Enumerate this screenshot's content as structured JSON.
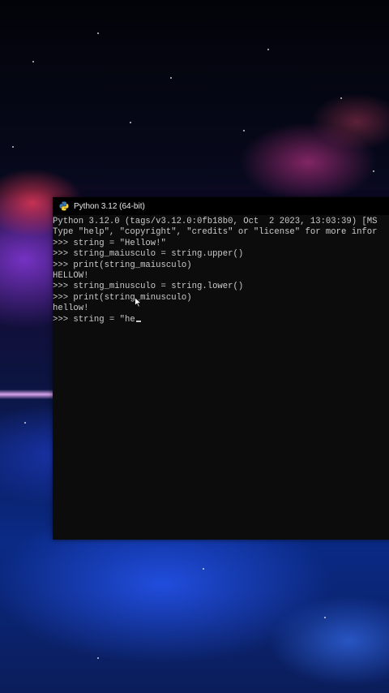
{
  "window": {
    "title": "Python 3.12 (64-bit)",
    "icon": "python-icon"
  },
  "console": {
    "lines": [
      "Python 3.12.0 (tags/v3.12.0:0fb18b0, Oct  2 2023, 13:03:39) [MS",
      "Type \"help\", \"copyright\", \"credits\" or \"license\" for more infor",
      ">>> string = \"Hellow!\"",
      ">>> string_maiusculo = string.upper()",
      ">>> print(string_maiusculo)",
      "HELLOW!",
      ">>> string_minusculo = string.lower()",
      ">>> print(string_minusculo)",
      "hellow!"
    ],
    "current_input": ">>> string = \"he"
  },
  "colors": {
    "console_bg": "#0c0c0c",
    "console_text": "#cccccc",
    "titlebar_bg": "#000000"
  }
}
